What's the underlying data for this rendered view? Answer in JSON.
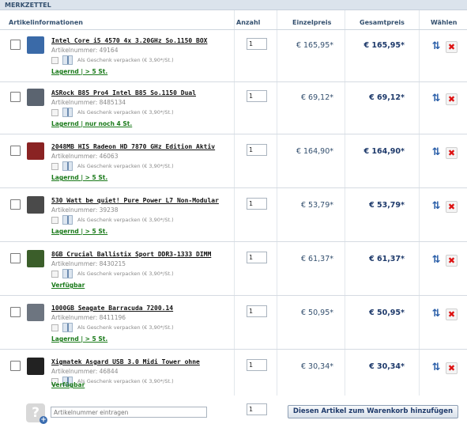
{
  "panel_title": "MERKZETTEL",
  "columns": {
    "info": "Artikelinformationen",
    "qty": "Anzahl",
    "unit": "Einzelpreis",
    "total": "Gesamtpreis",
    "select": "Wählen"
  },
  "gift_label": "Als Geschenk verpacken (€ 3,90*/St.)",
  "items": [
    {
      "title": "Intel Core i5 4570 4x 3.20GHz So.1150 BOX",
      "artno": "Artikelnummer: 49164",
      "stock": "Lagernd | > 5 St.",
      "qty": "1",
      "unit": "€ 165,95*",
      "total": "€ 165,95*",
      "thumb_color": "#3a6aa8"
    },
    {
      "title": "ASRock B85 Pro4 Intel B85 So.1150 Dual",
      "artno": "Artikelnummer: 8485134",
      "stock": "Lagernd | nur noch 4 St.",
      "qty": "1",
      "unit": "€ 69,12*",
      "total": "€ 69,12*",
      "thumb_color": "#5b6470"
    },
    {
      "title": "2048MB HIS Radeon HD 7870 GHz Edition Aktiv",
      "artno": "Artikelnummer: 46063",
      "stock": "Lagernd | > 5 St.",
      "qty": "1",
      "unit": "€ 164,90*",
      "total": "€ 164,90*",
      "thumb_color": "#8a2323"
    },
    {
      "title": "530 Watt be quiet! Pure Power L7 Non-Modular",
      "artno": "Artikelnummer: 39238",
      "stock": "Lagernd | > 5 St.",
      "qty": "1",
      "unit": "€ 53,79*",
      "total": "€ 53,79*",
      "thumb_color": "#4a4a4a"
    },
    {
      "title": "8GB Crucial Ballistix Sport DDR3-1333 DIMM",
      "artno": "Artikelnummer: 8430215",
      "stock": "Verfügbar",
      "qty": "1",
      "unit": "€ 61,37*",
      "total": "€ 61,37*",
      "thumb_color": "#3b5e2a"
    },
    {
      "title": "1000GB Seagate Barracuda 7200.14",
      "artno": "Artikelnummer: 8411196",
      "stock": "Lagernd | > 5 St.",
      "qty": "1",
      "unit": "€ 50,95*",
      "total": "€ 50,95*",
      "thumb_color": "#6d7580"
    },
    {
      "title": "Xigmatek Asgard USB 3.0 Midi Tower ohne",
      "artno": "Artikelnummer: 46844",
      "stock": "Verfügbar",
      "qty": "1",
      "unit": "€ 30,34*",
      "total": "€ 30,34*",
      "thumb_color": "#222222"
    }
  ],
  "footer": {
    "article_placeholder": "Artikelnummer eintragen",
    "qty": "1",
    "add_button": "Diesen Artikel zum Warenkorb hinzufügen"
  },
  "icons": {
    "swap": "swap-arrows-icon",
    "delete": "delete-x-icon",
    "help": "question-add-icon"
  }
}
